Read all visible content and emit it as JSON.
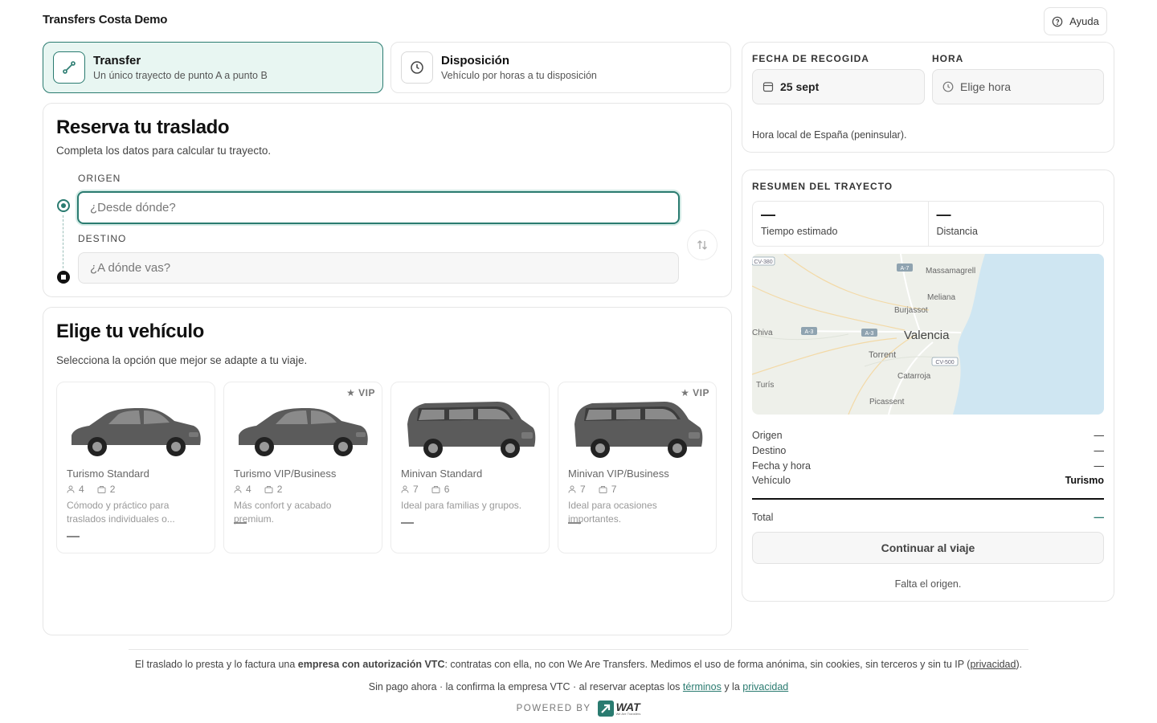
{
  "header": {
    "brand": "Transfers Costa Demo",
    "help_label": "Ayuda"
  },
  "modes": [
    {
      "title": "Transfer",
      "subtitle": "Un único trayecto de punto A a punto B",
      "icon": "route-icon",
      "active": true
    },
    {
      "title": "Disposición",
      "subtitle": "Vehículo por horas a tu disposición",
      "icon": "clock-icon",
      "active": false
    }
  ],
  "booking": {
    "title": "Reserva tu traslado",
    "subtitle": "Completa los datos para calcular tu trayecto.",
    "origin_label": "ORIGEN",
    "origin_placeholder": "¿Desde dónde?",
    "destination_label": "DESTINO",
    "destination_placeholder": "¿A dónde vas?"
  },
  "vehicles": {
    "title": "Elige tu vehículo",
    "subtitle": "Selecciona la opción que mejor se adapte a tu viaje.",
    "items": [
      {
        "name": "Turismo Standard",
        "pax": "4",
        "bags": "2",
        "desc": "Cómodo y práctico para traslados individuales o...",
        "vip": "",
        "type": "sedan",
        "price": "—"
      },
      {
        "name": "Turismo VIP/Business",
        "pax": "4",
        "bags": "2",
        "desc": "Más confort y acabado premium.",
        "vip": "★ VIP",
        "type": "sedan",
        "price": "—"
      },
      {
        "name": "Minivan Standard",
        "pax": "7",
        "bags": "6",
        "desc": "Ideal para familias y grupos.",
        "vip": "",
        "type": "van",
        "price": "—"
      },
      {
        "name": "Minivan VIP/Business",
        "pax": "7",
        "bags": "7",
        "desc": "Ideal para ocasiones importantes.",
        "vip": "★ VIP",
        "type": "van",
        "price": "—"
      }
    ]
  },
  "pickup": {
    "date_label": "FECHA DE RECOGIDA",
    "date_value": "25 sept",
    "time_label": "HORA",
    "time_value": "Elige hora",
    "tz_note": "Hora local de España (peninsular)."
  },
  "summary": {
    "title": "RESUMEN DEL TRAYECTO",
    "est_time_value": "—",
    "est_time_label": "Tiempo estimado",
    "distance_value": "—",
    "distance_label": "Distancia",
    "map_labels": {
      "valencia": "Valencia",
      "massamagrell": "Massamagrell",
      "meliana": "Meliana",
      "burjassot": "Burjassot",
      "torrent": "Torrent",
      "catarroja": "Catarroja",
      "picassent": "Picassent",
      "chiva": "Chiva",
      "turis": "Turís",
      "r_a7": "A-7",
      "r_a3a": "A-3",
      "r_a3b": "A-3",
      "r_cv500": "CV-500",
      "r_cv380": "CV-380"
    },
    "rows": [
      {
        "label": "Origen",
        "value": "—"
      },
      {
        "label": "Destino",
        "value": "—"
      },
      {
        "label": "Fecha y hora",
        "value": "—"
      },
      {
        "label": "Vehículo",
        "value": "Turismo"
      }
    ],
    "total_label": "Total",
    "total_value": "—",
    "continue_label": "Continuar al viaje",
    "missing_note": "Falta el origen."
  },
  "footer": {
    "line1_a": "El traslado lo presta y lo factura una ",
    "line1_b": "empresa con autorización VTC",
    "line1_c": ": contratas con ella, no con We Are Transfers. Medimos el uso de forma anónima, sin cookies, sin terceros y sin tu IP (",
    "line1_link": "privacidad",
    "line1_d": ").",
    "line2_a": "Sin pago ahora · la confirma la empresa VTC · al reservar aceptas los ",
    "line2_terms": "términos",
    "line2_b": " y la ",
    "line2_privacy": "privacidad",
    "powered": "POWERED BY",
    "logo_text": "WAT",
    "logo_sub": "We Are Transfers"
  },
  "colors": {
    "accent": "#2a7b70",
    "accent_bg": "#e8f6f2",
    "map_water": "#cfe6f2",
    "map_land": "#eef0ea"
  }
}
